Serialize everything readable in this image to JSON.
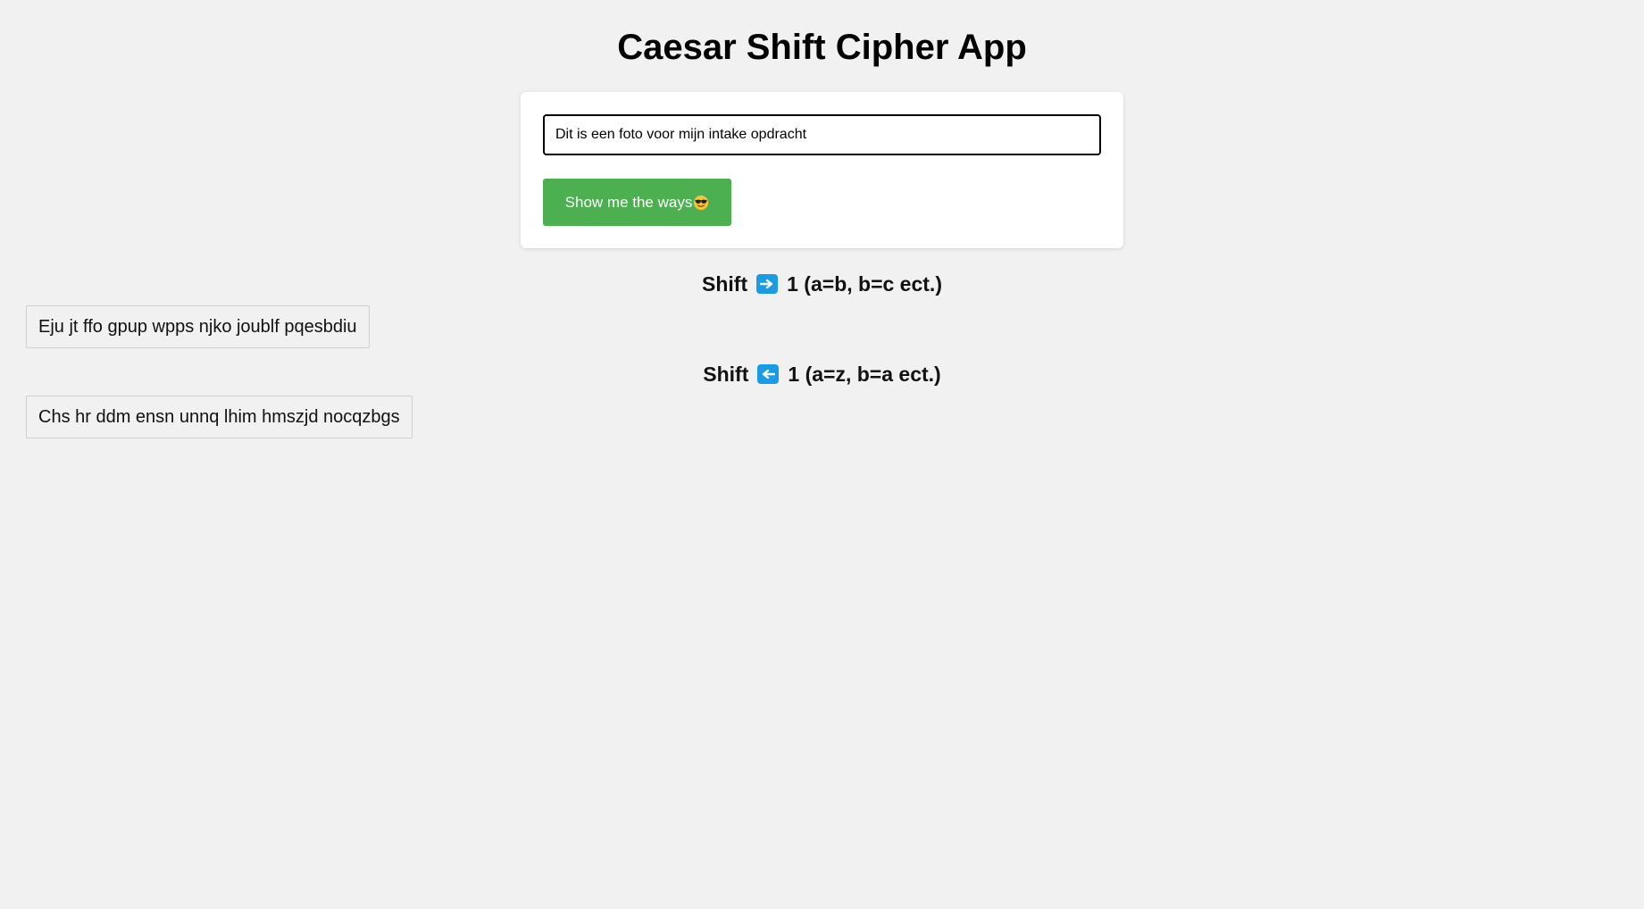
{
  "header": {
    "title": "Caesar Shift Cipher App"
  },
  "form": {
    "input_value": "Dit is een foto voor mijn intake opdracht",
    "submit_label": "Show me the ways",
    "submit_icon": "sunglasses-face-emoji-icon",
    "button_color": "#4caf50"
  },
  "results": [
    {
      "heading_prefix": "Shift",
      "direction_icon": "right-arrow-icon",
      "heading_suffix": "1 (a=b, b=c ect.)",
      "output": "Eju jt ffo gpup wpps njko joublf pqesbdiu"
    },
    {
      "heading_prefix": "Shift",
      "direction_icon": "left-arrow-icon",
      "heading_suffix": "1 (a=z, b=a ect.)",
      "output": "Chs hr ddm ensn unnq lhim hmszjd nocqzbgs"
    }
  ],
  "colors": {
    "background": "#f1f1f1",
    "arrow_badge": "#1a9be6"
  }
}
